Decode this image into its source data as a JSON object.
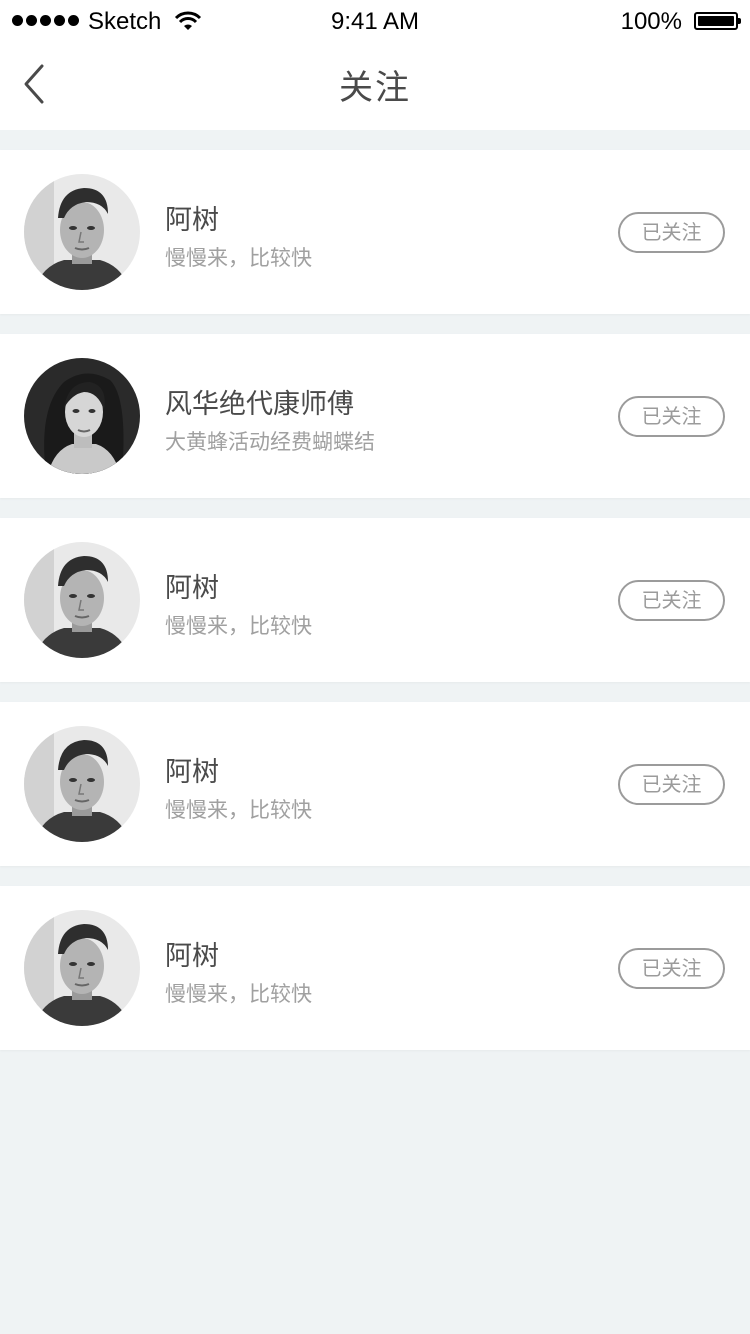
{
  "status_bar": {
    "carrier": "Sketch",
    "time": "9:41 AM",
    "battery": "100%"
  },
  "nav": {
    "title": "关注",
    "back_icon": "chevron-left-icon"
  },
  "follows": [
    {
      "name": "阿树",
      "desc": "慢慢来，比较快",
      "button": "已关注",
      "avatar": "male"
    },
    {
      "name": "风华绝代康师傅",
      "desc": "大黄蜂活动经费蝴蝶结",
      "button": "已关注",
      "avatar": "female"
    },
    {
      "name": "阿树",
      "desc": "慢慢来，比较快",
      "button": "已关注",
      "avatar": "male"
    },
    {
      "name": "阿树",
      "desc": "慢慢来，比较快",
      "button": "已关注",
      "avatar": "male"
    },
    {
      "name": "阿树",
      "desc": "慢慢来，比较快",
      "button": "已关注",
      "avatar": "male"
    }
  ],
  "colors": {
    "background": "#eff3f4",
    "text": "#4a4a4a",
    "subtext": "#a0a0a0",
    "button_border": "#9b9b9b"
  }
}
